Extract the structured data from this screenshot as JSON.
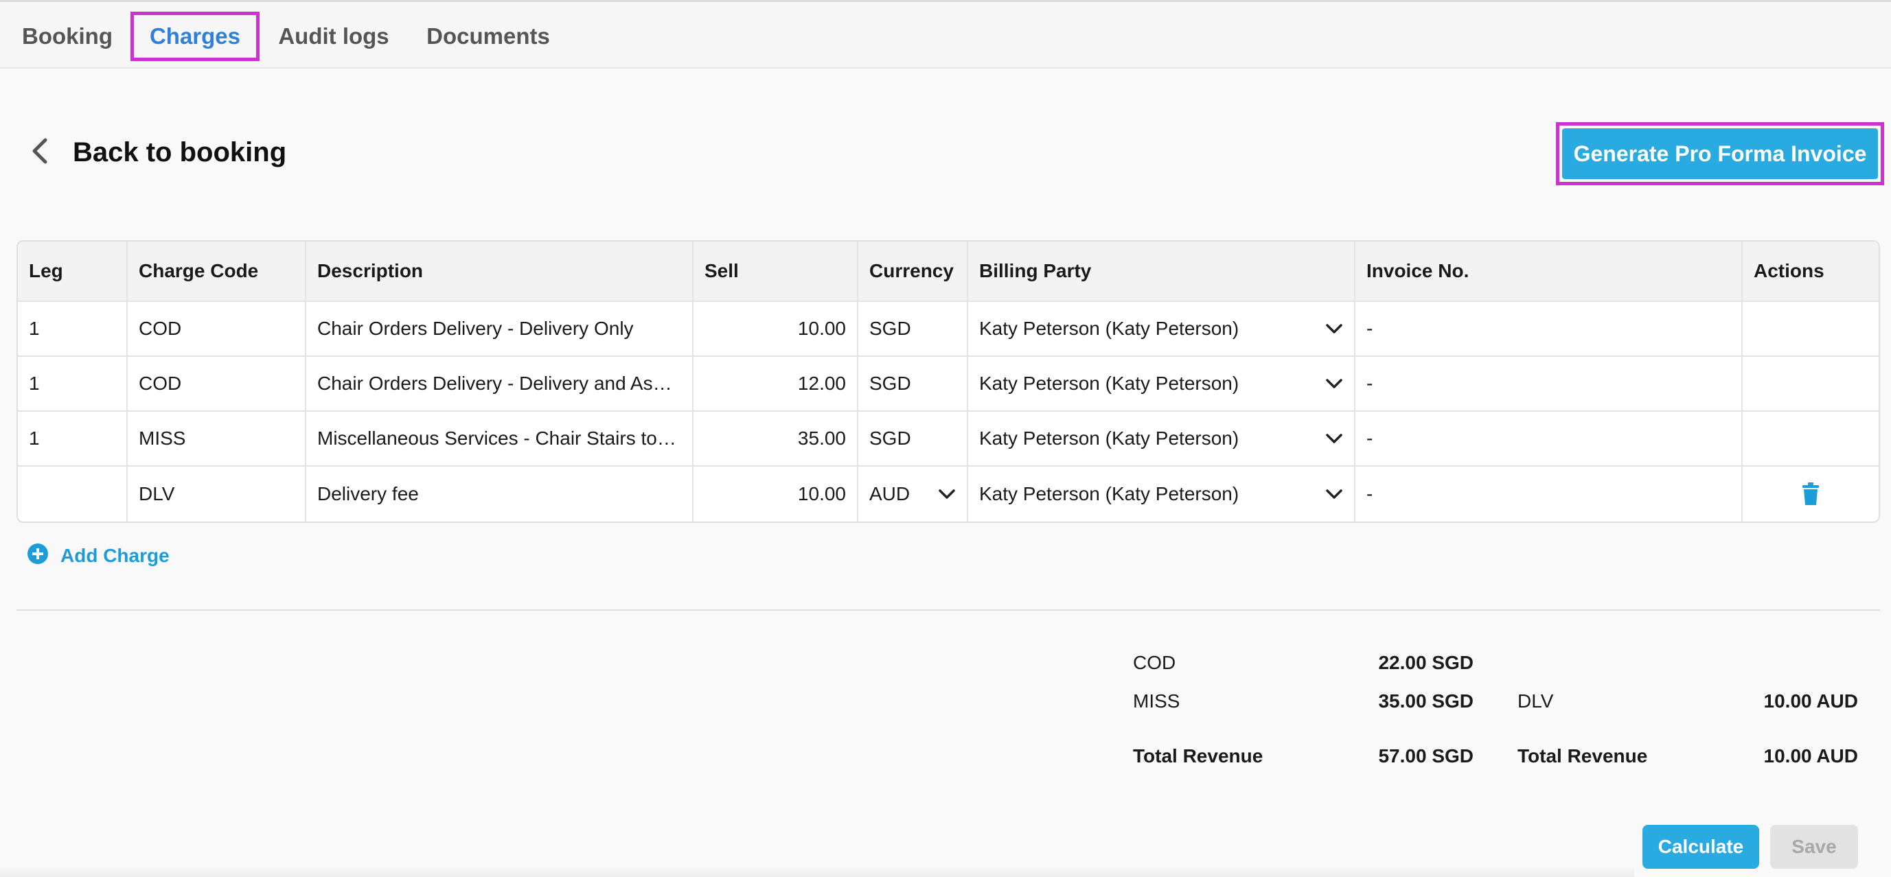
{
  "tabs": [
    {
      "label": "Booking"
    },
    {
      "label": "Charges"
    },
    {
      "label": "Audit logs"
    },
    {
      "label": "Documents"
    }
  ],
  "header": {
    "back_label": "Back to booking",
    "generate_button": "Generate Pro Forma Invoice"
  },
  "table": {
    "columns": [
      "Leg",
      "Charge Code",
      "Description",
      "Sell",
      "Currency",
      "Billing Party",
      "Invoice No.",
      "Actions"
    ],
    "rows": [
      {
        "leg": "1",
        "code": "COD",
        "description": "Chair Orders Delivery - Delivery Only",
        "sell": "10.00",
        "currency": "SGD",
        "billing_party": "Katy Peterson (Katy Peterson)",
        "invoice": "-"
      },
      {
        "leg": "1",
        "code": "COD",
        "description": "Chair Orders Delivery - Delivery and Ass…",
        "sell": "12.00",
        "currency": "SGD",
        "billing_party": "Katy Peterson (Katy Peterson)",
        "invoice": "-"
      },
      {
        "leg": "1",
        "code": "MISS",
        "description": "Miscellaneous Services - Chair Stairs tot…",
        "sell": "35.00",
        "currency": "SGD",
        "billing_party": "Katy Peterson (Katy Peterson)",
        "invoice": "-"
      },
      {
        "leg": "",
        "code": "DLV",
        "description": "Delivery fee",
        "sell": "10.00",
        "currency": "AUD",
        "billing_party": "Katy Peterson (Katy Peterson)",
        "invoice": "-"
      }
    ]
  },
  "add_charge_label": "Add Charge",
  "summary": {
    "sgd": [
      {
        "code": "COD",
        "amount": "22.00 SGD"
      },
      {
        "code": "MISS",
        "amount": "35.00 SGD"
      }
    ],
    "aud": [
      {
        "code": "DLV",
        "amount": "10.00 AUD"
      }
    ],
    "total_label": "Total Revenue",
    "total_sgd": "57.00 SGD",
    "total_aud": "10.00 AUD"
  },
  "buttons": {
    "calculate": "Calculate",
    "save": "Save"
  },
  "colors": {
    "accent": "#29abe2",
    "highlight": "#cc33cc",
    "active_tab": "#2f80d6"
  },
  "icons": {
    "back": "chevron-left-icon",
    "dropdown": "chevron-down-icon",
    "delete": "trash-icon",
    "add": "plus-circle-icon"
  }
}
